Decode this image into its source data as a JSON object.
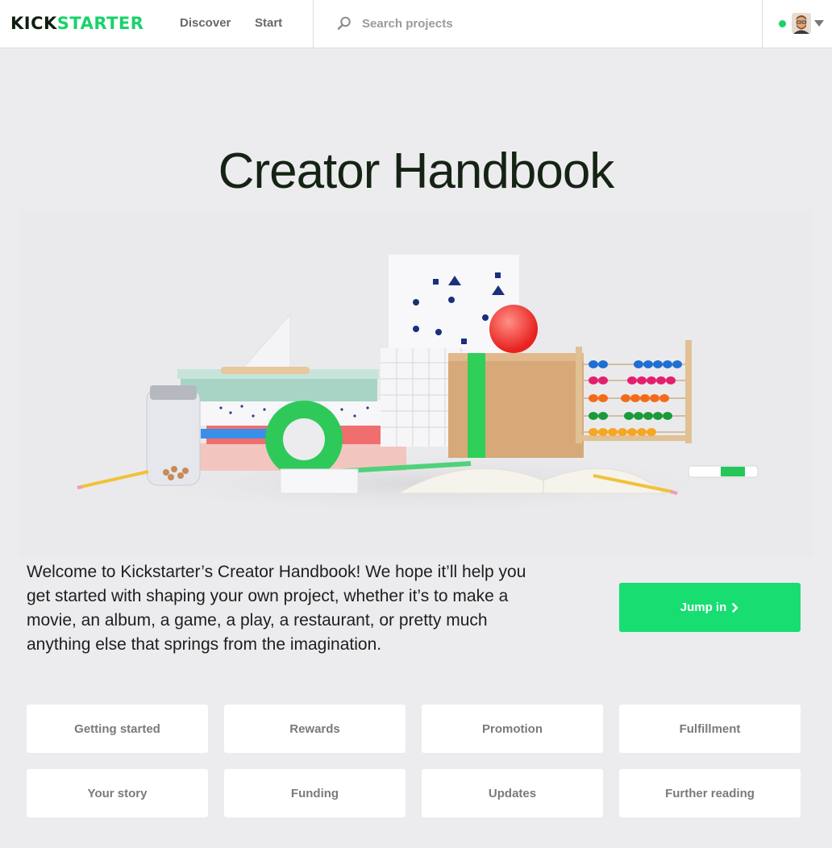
{
  "header": {
    "logo_left": "KICK",
    "logo_right": "STARTER",
    "nav": {
      "discover": "Discover",
      "start": "Start"
    },
    "search": {
      "placeholder": "Search projects",
      "icon": "search-icon"
    },
    "user": {
      "online_status_color": "#18d36a",
      "avatar": "avatar"
    }
  },
  "main": {
    "title": "Creator Handbook",
    "intro": "Welcome to Kickstarter’s Creator Handbook! We hope it’ll help you get started with shaping your own project, whether it’s to make a movie, an album, a game, a play, a restaurant, or pretty much anything else that springs from the imagination.",
    "jump_label": "Jump in",
    "sections": [
      {
        "label": "Getting started"
      },
      {
        "label": "Rewards"
      },
      {
        "label": "Promotion"
      },
      {
        "label": "Fulfillment"
      },
      {
        "label": "Your story"
      },
      {
        "label": "Funding"
      },
      {
        "label": "Updates"
      },
      {
        "label": "Further reading"
      }
    ]
  },
  "colors": {
    "brand_green": "#18d36a",
    "button_green": "#18de72",
    "background": "#ececee"
  }
}
